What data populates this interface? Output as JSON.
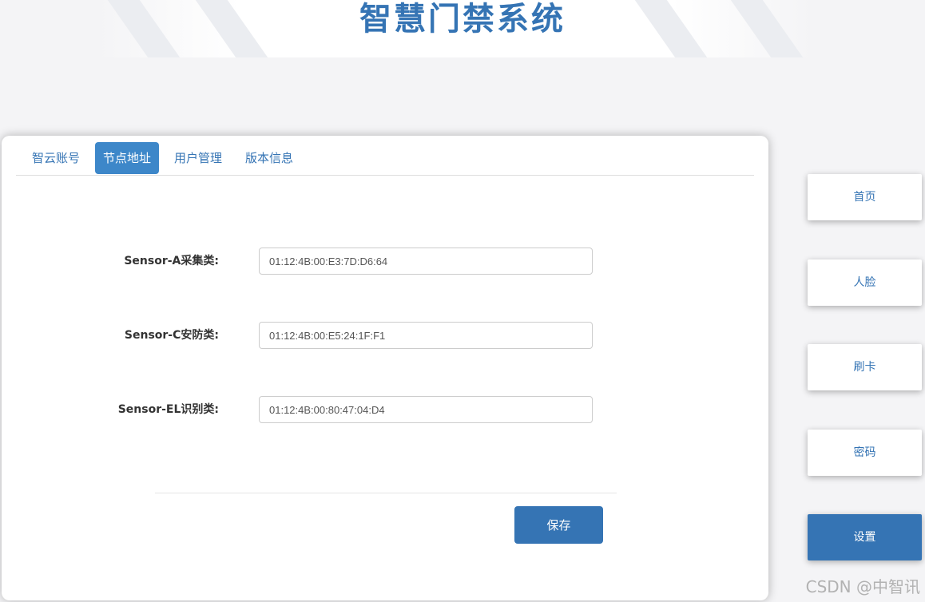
{
  "header": {
    "title": "智慧门禁系统"
  },
  "tabs": [
    {
      "label": "智云账号"
    },
    {
      "label": "节点地址",
      "active": true
    },
    {
      "label": "用户管理"
    },
    {
      "label": "版本信息"
    }
  ],
  "form": {
    "fields": [
      {
        "label": "Sensor-A采集类:",
        "value": "01:12:4B:00:E3:7D:D6:64"
      },
      {
        "label": "Sensor-C安防类:",
        "value": "01:12:4B:00:E5:24:1F:F1"
      },
      {
        "label": "Sensor-EL识别类:",
        "value": "01:12:4B:00:80:47:04:D4"
      }
    ],
    "save_label": "保存"
  },
  "nav": [
    {
      "label": "首页"
    },
    {
      "label": "人脸"
    },
    {
      "label": "刷卡"
    },
    {
      "label": "密码"
    },
    {
      "label": "设置",
      "active": true
    }
  ],
  "watermark": "CSDN @中智讯",
  "colors": {
    "accent": "#3574b4",
    "tab_active": "#3d87c9"
  }
}
